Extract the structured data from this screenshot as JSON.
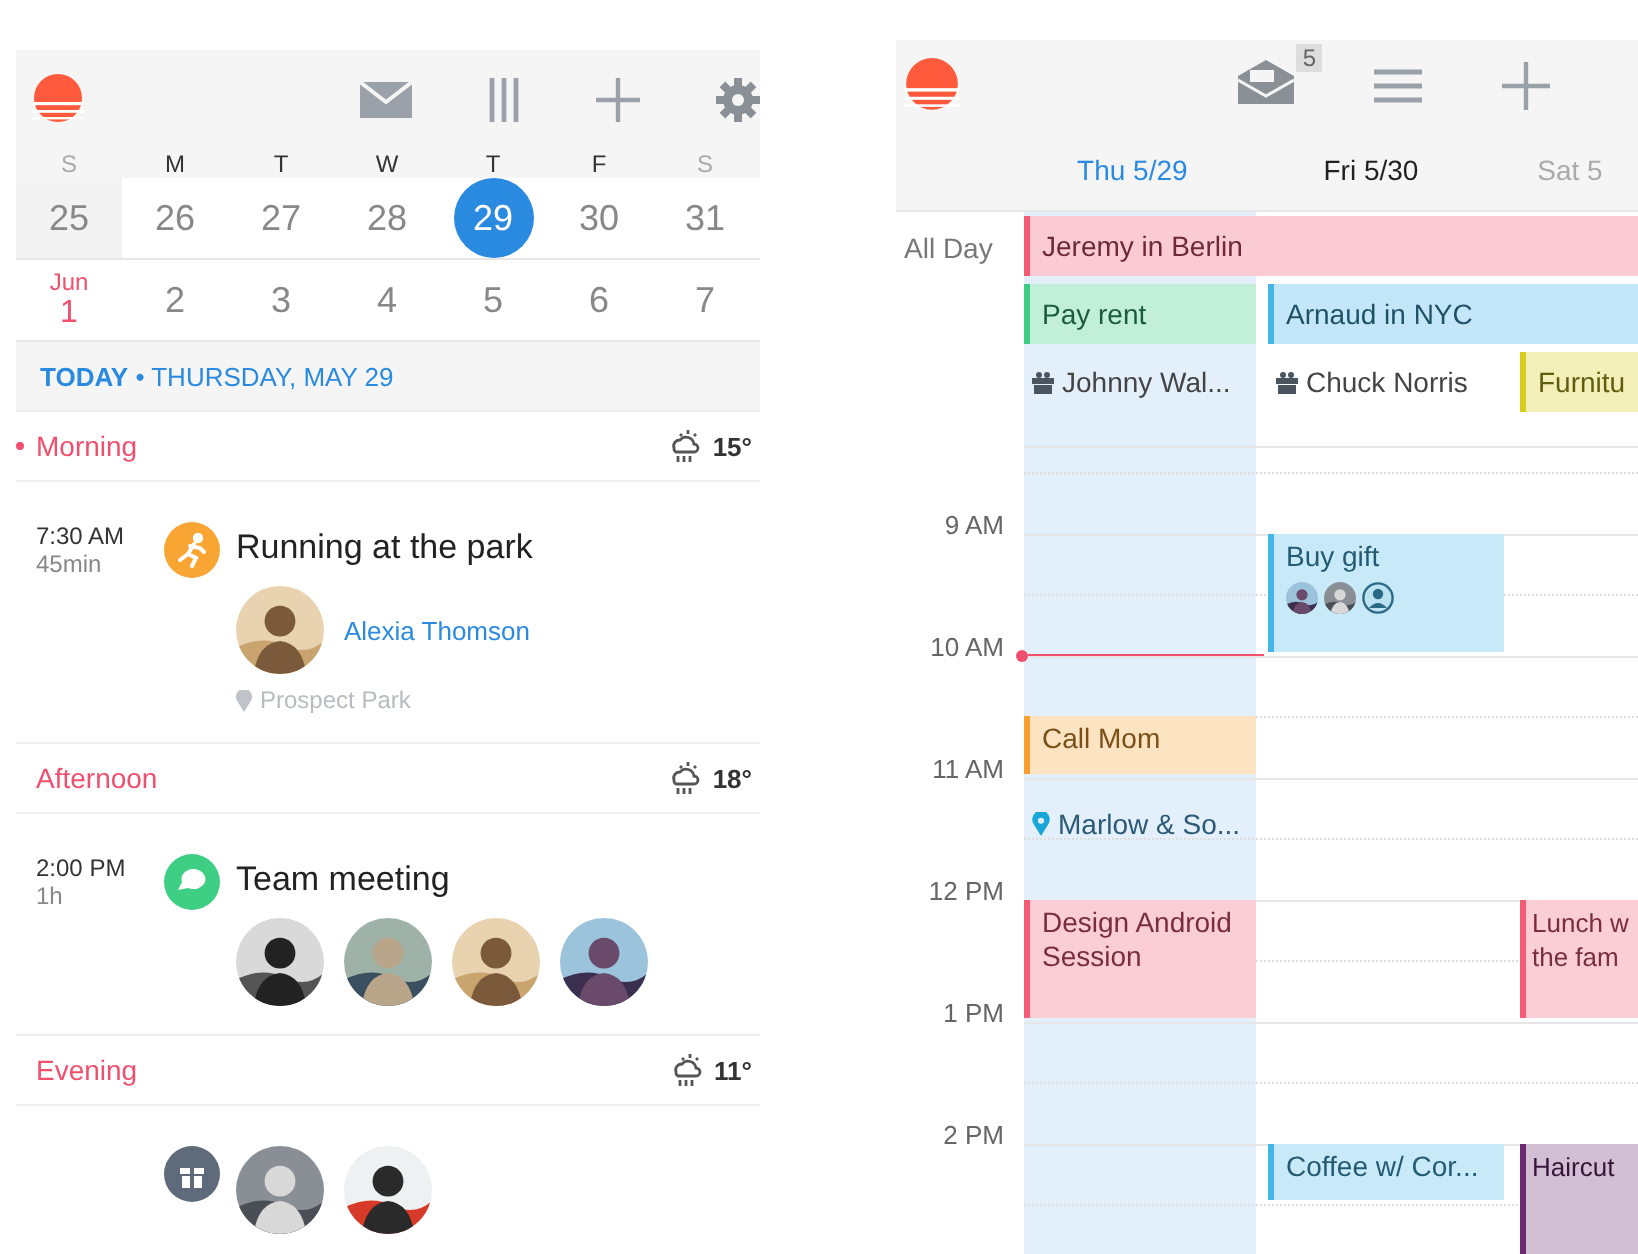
{
  "agenda": {
    "weekdays": [
      {
        "label": "S",
        "weekend": true
      },
      {
        "label": "M",
        "weekend": false
      },
      {
        "label": "T",
        "weekend": false
      },
      {
        "label": "W",
        "weekend": false
      },
      {
        "label": "T",
        "weekend": false
      },
      {
        "label": "F",
        "weekend": false
      },
      {
        "label": "S",
        "weekend": true
      }
    ],
    "weeks": [
      [
        {
          "day": "25",
          "past": true,
          "selected": false
        },
        {
          "day": "26",
          "past": false,
          "selected": false
        },
        {
          "day": "27",
          "past": false,
          "selected": false
        },
        {
          "day": "28",
          "past": false,
          "selected": false
        },
        {
          "day": "29",
          "past": false,
          "selected": true
        },
        {
          "day": "30",
          "past": false,
          "selected": false
        },
        {
          "day": "31",
          "past": false,
          "selected": false
        }
      ],
      [
        {
          "month": "Jun",
          "day": "1",
          "past": false,
          "selected": false
        },
        {
          "day": "2",
          "past": false,
          "selected": false
        },
        {
          "day": "3",
          "past": false,
          "selected": false
        },
        {
          "day": "4",
          "past": false,
          "selected": false
        },
        {
          "day": "5",
          "past": false,
          "selected": false
        },
        {
          "day": "6",
          "past": false,
          "selected": false
        },
        {
          "day": "7",
          "past": false,
          "selected": false
        }
      ]
    ],
    "today_header": {
      "today": "TODAY",
      "separator": "•",
      "date": "THURSDAY, MAY 29"
    },
    "sections": [
      {
        "name": "Morning",
        "now": true,
        "temperature": "15°",
        "events": [
          {
            "time": "7:30 AM",
            "duration": "45min",
            "title": "Running at the park",
            "color": "#f9a533",
            "attendees": [
              {
                "kind": "picture",
                "name": "Alexia Thomson"
              }
            ],
            "location": "Prospect Park"
          }
        ]
      },
      {
        "name": "Afternoon",
        "now": false,
        "temperature": "18°",
        "events": [
          {
            "time": "2:00 PM",
            "duration": "1h",
            "title": "Team meeting",
            "color": "#3fcf84",
            "attendees": [
              {
                "kind": "picture"
              },
              {
                "kind": "picture"
              },
              {
                "kind": "picture"
              },
              {
                "kind": "picture"
              }
            ]
          }
        ]
      },
      {
        "name": "Evening",
        "now": false,
        "temperature": "11°",
        "events": [
          {
            "color": "#5f6b7a",
            "attendees": [
              {
                "kind": "picture"
              },
              {
                "kind": "picture"
              }
            ]
          }
        ]
      }
    ]
  },
  "week": {
    "inbox_count": "5",
    "days": [
      {
        "label": "Thu 5/29",
        "selected": true,
        "weekend": false
      },
      {
        "label": "Fri 5/30",
        "selected": false,
        "weekend": false
      },
      {
        "label": "Sat 5",
        "selected": false,
        "weekend": true
      }
    ],
    "all_day_label": "All Day",
    "all_day_rows": [
      [
        {
          "title": "Jeremy in Berlin",
          "kind": "bar",
          "color": "#f25c75"
        }
      ],
      [
        {
          "title": "Pay rent",
          "kind": "bar",
          "color": "#3dcc85"
        },
        {
          "title": "Arnaud in NYC",
          "kind": "bar",
          "color": "#45b5e8"
        }
      ],
      [
        {
          "title": "Johnny Wal...",
          "kind": "birthday"
        },
        {
          "title": "Chuck Norris",
          "kind": "birthday"
        },
        {
          "title": "Furnitu",
          "kind": "bar",
          "color": "#d8cc20"
        }
      ]
    ],
    "hours": [
      "9 AM",
      "10 AM",
      "11 AM",
      "12 PM",
      "1 PM",
      "2 PM"
    ],
    "events": [
      {
        "title": "Buy gift",
        "kind": "block",
        "color": "#45b5e8",
        "attendees": [
          {
            "kind": "picture"
          },
          {
            "kind": "picture"
          },
          {
            "kind": "placeholder"
          }
        ]
      },
      {
        "title": "Call Mom",
        "kind": "block",
        "color": "#f5a030"
      },
      {
        "title": "Marlow & So...",
        "kind": "place"
      },
      {
        "title": "Design Android Session",
        "kind": "block",
        "color": "#f25c75"
      },
      {
        "title": "Lunch w the fam",
        "kind": "block",
        "color": "#f25c75"
      },
      {
        "title": "Coffee w/ Cor...",
        "kind": "block",
        "color": "#45b5e8"
      },
      {
        "title": "Haircut",
        "kind": "block",
        "color": "#6a2a70"
      }
    ]
  }
}
